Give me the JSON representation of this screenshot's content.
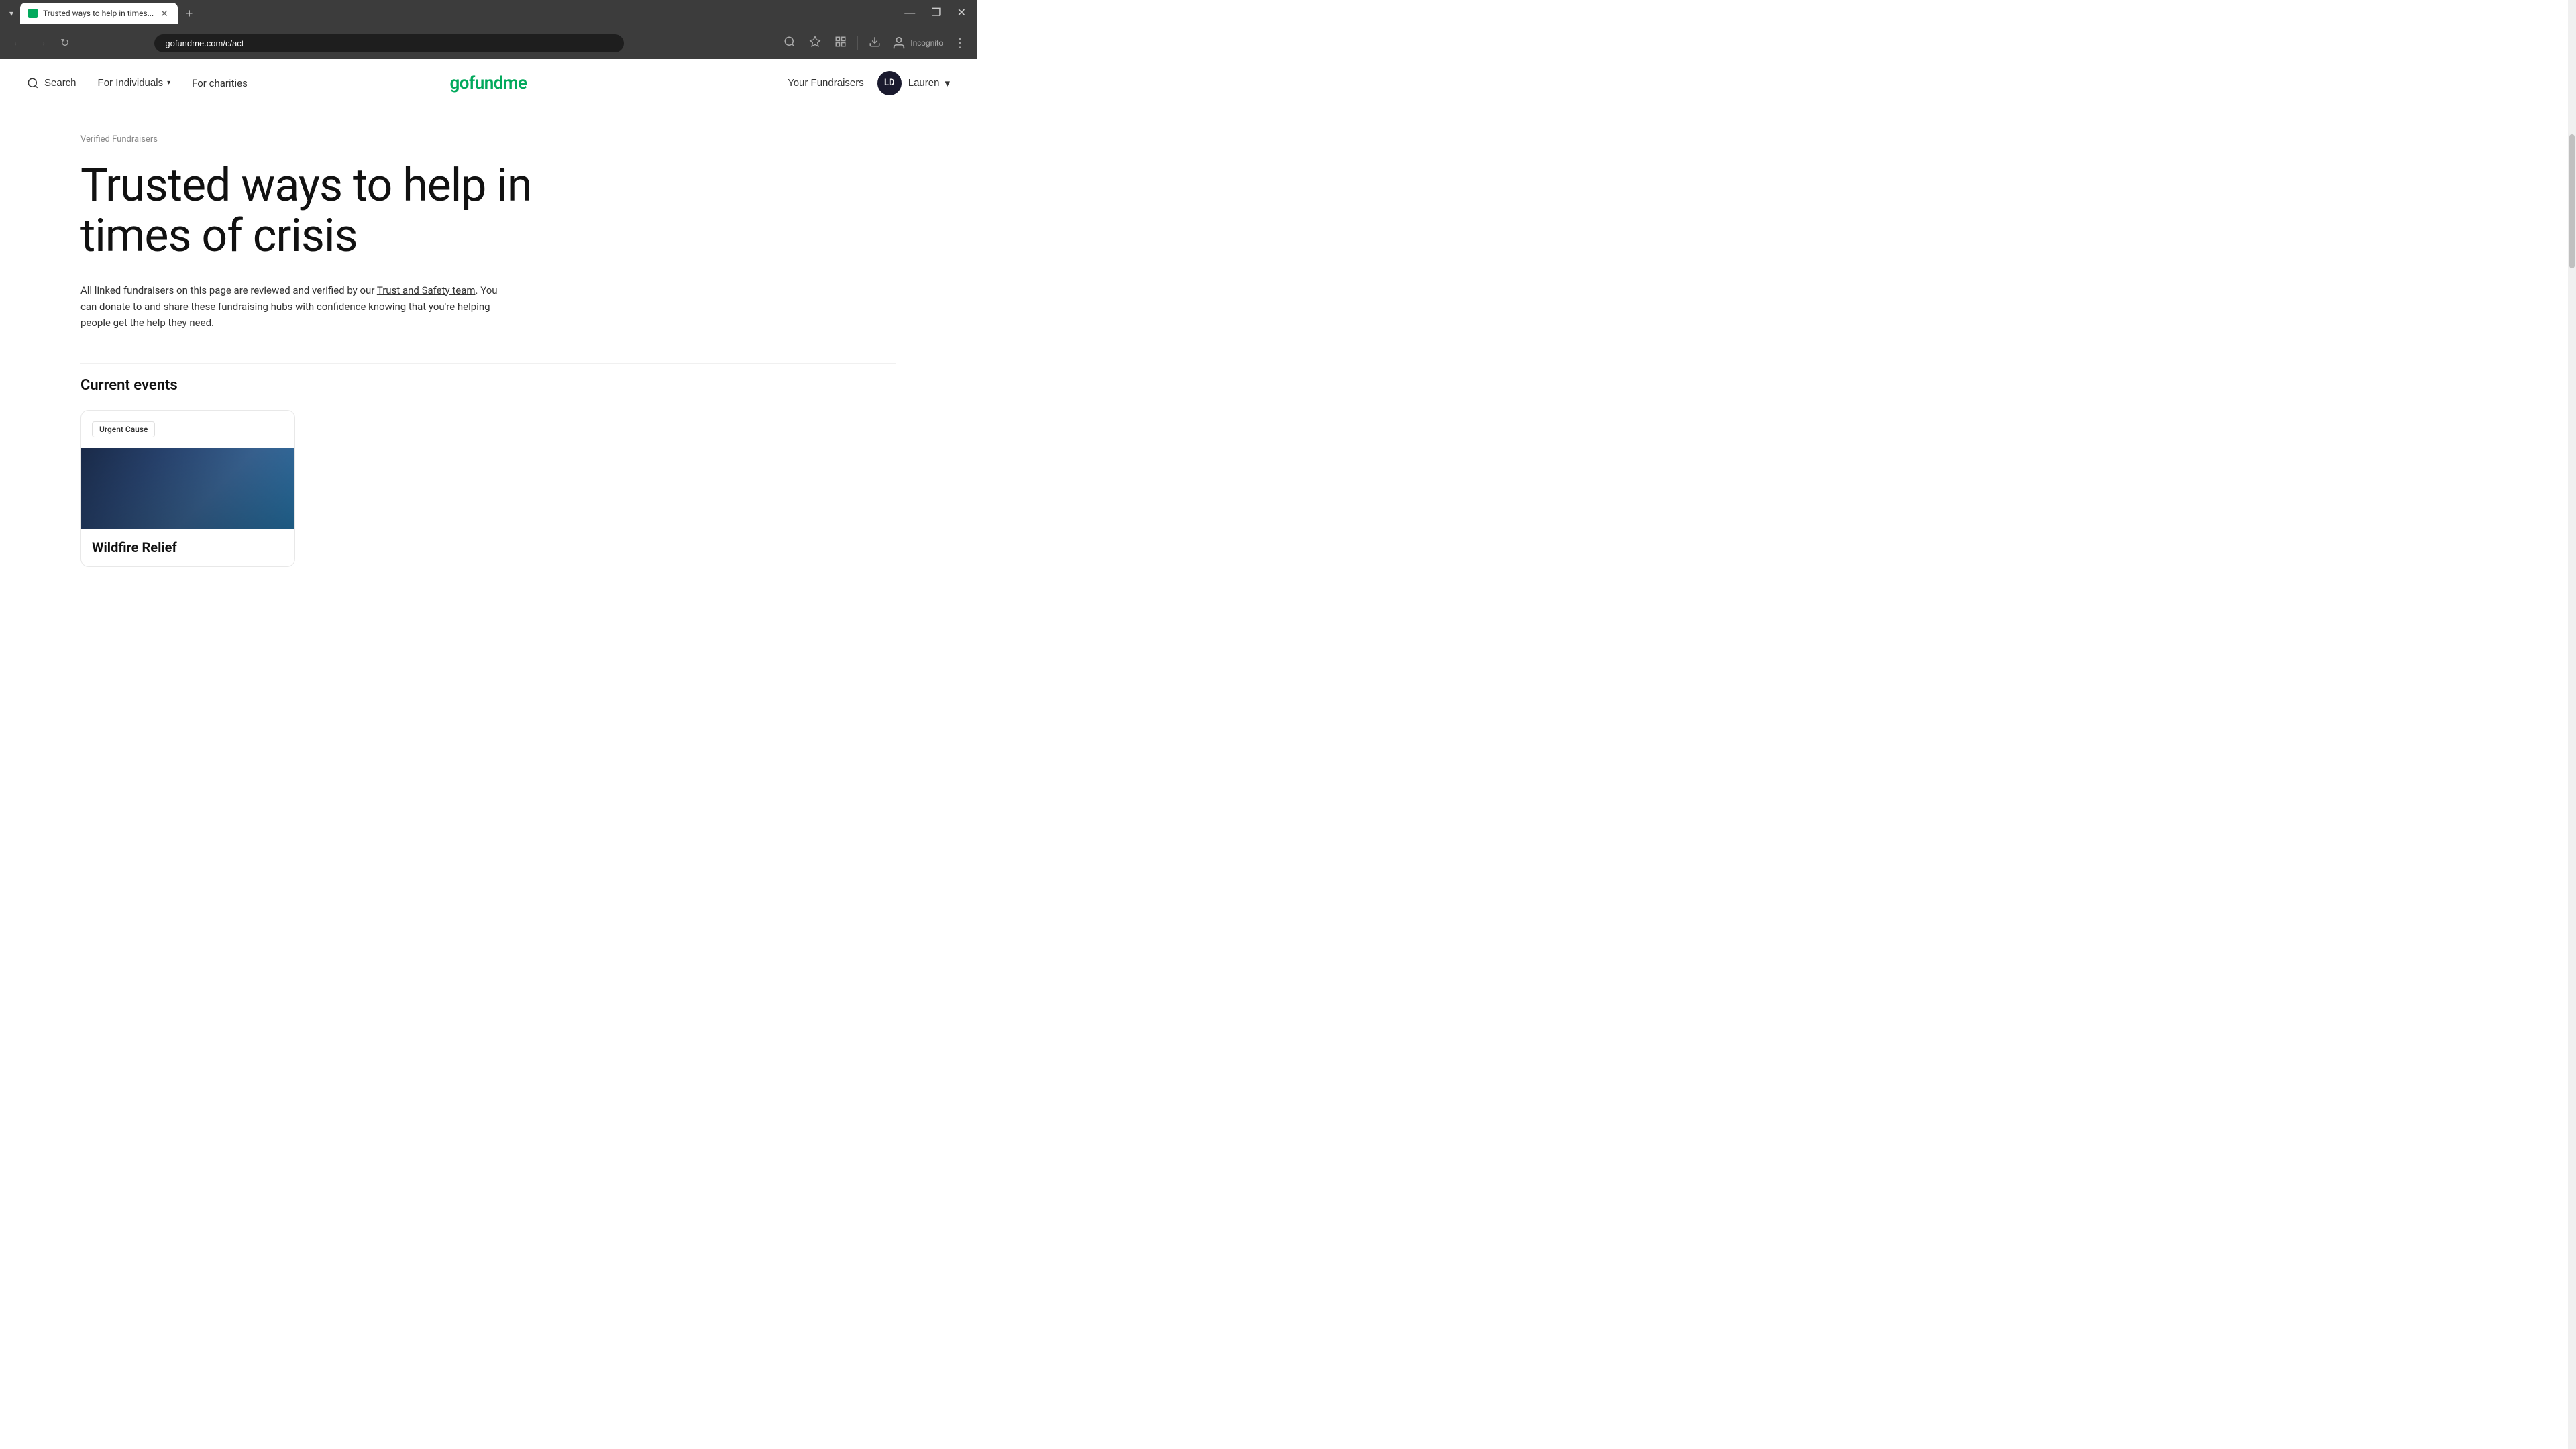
{
  "browser": {
    "tab": {
      "title": "Trusted ways to help in times...",
      "favicon_color": "#02a95c",
      "url": "gofundme.com/c/act"
    },
    "window_controls": {
      "minimize": "—",
      "maximize": "❐",
      "close": "✕"
    },
    "nav_buttons": {
      "back": "←",
      "forward": "→",
      "refresh": "↻",
      "new_tab": "+"
    },
    "browser_actions": {
      "search_icon": "🔍",
      "star_icon": "☆",
      "extensions_icon": "🧩",
      "download_icon": "⬇",
      "incognito_label": "Incognito",
      "menu_icon": "⋮"
    }
  },
  "nav": {
    "search_label": "Search",
    "for_individuals_label": "For Individuals",
    "for_charities_label": "For charities",
    "logo_text": "gofundme",
    "your_fundraisers_label": "Your Fundraisers",
    "user_initials": "LD",
    "user_name": "Lauren"
  },
  "page": {
    "breadcrumb": "Verified Fundraisers",
    "hero_title": "Trusted ways to help in times of crisis",
    "hero_description_part1": "All linked fundraisers on this page are reviewed and verified by our ",
    "trust_link_text": "Trust and Safety team",
    "hero_description_part2": ". You can donate to and share these fundraising hubs with confidence knowing that you're helping people get the help they need.",
    "current_events_title": "Current events",
    "event_card": {
      "badge": "Urgent Cause",
      "title": "Wildfire Relief"
    }
  }
}
